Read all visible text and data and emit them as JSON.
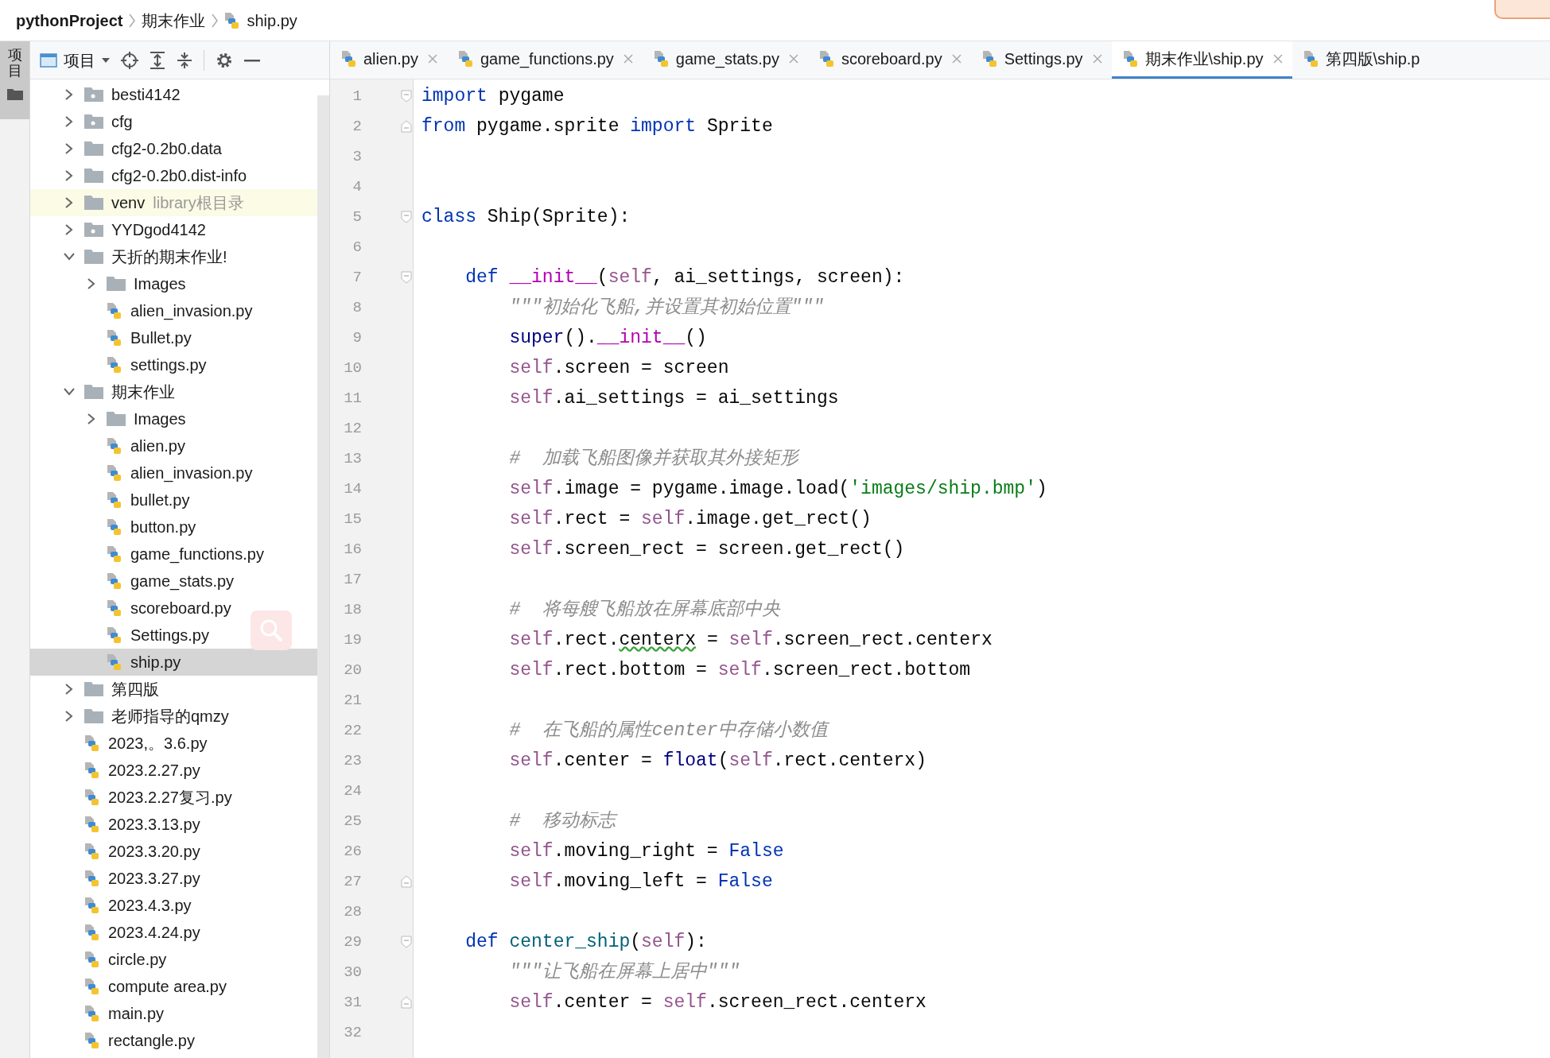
{
  "breadcrumb": [
    {
      "text": "pythonProject",
      "kind": "project"
    },
    {
      "text": "期末作业",
      "kind": "folder"
    },
    {
      "text": "ship.py",
      "kind": "file"
    }
  ],
  "tool_strip": {
    "label": "项目"
  },
  "project_panel": {
    "title": "项目"
  },
  "project_tree": [
    {
      "name": "besti4142",
      "kind": "marked_folder",
      "expanded": false,
      "selected": false,
      "highlighted": false
    },
    {
      "name": "cfg",
      "kind": "marked_folder",
      "expanded": false,
      "selected": false,
      "highlighted": false
    },
    {
      "name": "cfg2-0.2b0.data",
      "kind": "folder",
      "expanded": false,
      "selected": false,
      "highlighted": false
    },
    {
      "name": "cfg2-0.2b0.dist-info",
      "kind": "folder",
      "expanded": false,
      "selected": false,
      "highlighted": false
    },
    {
      "name": "venv",
      "note": "library根目录",
      "kind": "folder",
      "expanded": false,
      "selected": false,
      "highlighted": true
    },
    {
      "name": "YYDgod4142",
      "kind": "marked_folder",
      "expanded": false,
      "selected": false,
      "highlighted": false
    },
    {
      "name": "天折的期末作业!",
      "kind": "folder",
      "expanded": true,
      "selected": false,
      "highlighted": false,
      "children": [
        {
          "name": "Images",
          "kind": "folder",
          "expanded": false,
          "selected": false,
          "highlighted": false
        },
        {
          "name": "alien_invasion.py",
          "kind": "file",
          "selected": false,
          "highlighted": false
        },
        {
          "name": "Bullet.py",
          "kind": "file",
          "selected": false,
          "highlighted": false
        },
        {
          "name": "settings.py",
          "kind": "file",
          "selected": false,
          "highlighted": false
        }
      ]
    },
    {
      "name": "期末作业",
      "kind": "folder",
      "expanded": true,
      "selected": false,
      "highlighted": false,
      "children": [
        {
          "name": "Images",
          "kind": "folder",
          "expanded": false,
          "selected": false,
          "highlighted": false
        },
        {
          "name": "alien.py",
          "kind": "file",
          "selected": false,
          "highlighted": false
        },
        {
          "name": "alien_invasion.py",
          "kind": "file",
          "selected": false,
          "highlighted": false
        },
        {
          "name": "bullet.py",
          "kind": "file",
          "selected": false,
          "highlighted": false
        },
        {
          "name": "button.py",
          "kind": "file",
          "selected": false,
          "highlighted": false
        },
        {
          "name": "game_functions.py",
          "kind": "file",
          "selected": false,
          "highlighted": false
        },
        {
          "name": "game_stats.py",
          "kind": "file",
          "selected": false,
          "highlighted": false
        },
        {
          "name": "scoreboard.py",
          "kind": "file",
          "selected": false,
          "highlighted": false
        },
        {
          "name": "Settings.py",
          "kind": "file",
          "selected": false,
          "highlighted": false
        },
        {
          "name": "ship.py",
          "kind": "file",
          "selected": true,
          "highlighted": false
        }
      ]
    },
    {
      "name": "第四版",
      "kind": "folder",
      "expanded": false,
      "selected": false,
      "highlighted": false
    },
    {
      "name": "老师指导的qmzy",
      "kind": "folder",
      "expanded": false,
      "selected": false,
      "highlighted": false
    },
    {
      "name": "2023,。3.6.py",
      "kind": "file",
      "selected": false,
      "highlighted": false
    },
    {
      "name": "2023.2.27.py",
      "kind": "file",
      "selected": false,
      "highlighted": false
    },
    {
      "name": "2023.2.27复习.py",
      "kind": "file",
      "selected": false,
      "highlighted": false
    },
    {
      "name": "2023.3.13.py",
      "kind": "file",
      "selected": false,
      "highlighted": false
    },
    {
      "name": "2023.3.20.py",
      "kind": "file",
      "selected": false,
      "highlighted": false
    },
    {
      "name": "2023.3.27.py",
      "kind": "file",
      "selected": false,
      "highlighted": false
    },
    {
      "name": "2023.4.3.py",
      "kind": "file",
      "selected": false,
      "highlighted": false
    },
    {
      "name": "2023.4.24.py",
      "kind": "file",
      "selected": false,
      "highlighted": false
    },
    {
      "name": "circle.py",
      "kind": "file",
      "selected": false,
      "highlighted": false
    },
    {
      "name": "compute area.py",
      "kind": "file",
      "selected": false,
      "highlighted": false
    },
    {
      "name": "main.py",
      "kind": "file",
      "selected": false,
      "highlighted": false
    },
    {
      "name": "rectangle.py",
      "kind": "file",
      "selected": false,
      "highlighted": false
    }
  ],
  "tabs": [
    {
      "label": "alien.py",
      "selected": false,
      "closable": true
    },
    {
      "label": "game_functions.py",
      "selected": false,
      "closable": true
    },
    {
      "label": "game_stats.py",
      "selected": false,
      "closable": true
    },
    {
      "label": "scoreboard.py",
      "selected": false,
      "closable": true
    },
    {
      "label": "Settings.py",
      "selected": false,
      "closable": true
    },
    {
      "label": "期末作业\\ship.py",
      "selected": true,
      "closable": true
    },
    {
      "label": "第四版\\ship.p",
      "selected": false,
      "closable": false
    }
  ],
  "editor": {
    "lines": [
      {
        "number": "1",
        "fold_start": true,
        "fold_end": false,
        "code": [
          {
            "kind": "keyword",
            "text": "import"
          },
          {
            "kind": "plain",
            "text": " pygame"
          }
        ]
      },
      {
        "number": "2",
        "fold_start": false,
        "fold_end": true,
        "code": [
          {
            "kind": "keyword",
            "text": "from"
          },
          {
            "kind": "plain",
            "text": " pygame.sprite "
          },
          {
            "kind": "keyword",
            "text": "import"
          },
          {
            "kind": "plain",
            "text": " Sprite"
          }
        ]
      },
      {
        "number": "3",
        "fold_start": false,
        "fold_end": false
      },
      {
        "number": "4",
        "fold_start": false,
        "fold_end": false
      },
      {
        "number": "5",
        "fold_start": true,
        "fold_end": false,
        "code": [
          {
            "kind": "keyword",
            "text": "class"
          },
          {
            "kind": "plain",
            "text": " Ship(Sprite):"
          }
        ]
      },
      {
        "number": "6",
        "fold_start": false,
        "fold_end": false
      },
      {
        "number": "7",
        "fold_start": true,
        "fold_end": false,
        "code": [
          {
            "kind": "keyword",
            "text": "    def "
          },
          {
            "kind": "magic",
            "text": "__init__"
          },
          {
            "kind": "plain",
            "text": "("
          },
          {
            "kind": "self",
            "text": "self"
          },
          {
            "kind": "plain",
            "text": ", ai_settings, screen):"
          }
        ]
      },
      {
        "number": "8",
        "fold_start": false,
        "fold_end": false,
        "code": [
          {
            "kind": "comment",
            "text": "        \"\"\"初始化飞船,并设置其初始位置\"\"\""
          }
        ]
      },
      {
        "number": "9",
        "fold_start": false,
        "fold_end": false,
        "code": [
          {
            "kind": "builtin",
            "text": "        super"
          },
          {
            "kind": "plain",
            "text": "()."
          },
          {
            "kind": "magic",
            "text": "__init__"
          },
          {
            "kind": "plain",
            "text": "()"
          }
        ]
      },
      {
        "number": "10",
        "fold_start": false,
        "fold_end": false,
        "code": [
          {
            "kind": "self",
            "text": "        self"
          },
          {
            "kind": "plain",
            "text": ".screen = screen"
          }
        ]
      },
      {
        "number": "11",
        "fold_start": false,
        "fold_end": false,
        "code": [
          {
            "kind": "self",
            "text": "        self"
          },
          {
            "kind": "plain",
            "text": ".ai_settings = ai_settings"
          }
        ]
      },
      {
        "number": "12",
        "fold_start": false,
        "fold_end": false
      },
      {
        "number": "13",
        "fold_start": false,
        "fold_end": false,
        "code": [
          {
            "kind": "comment",
            "text": "        #  加载飞船图像并获取其外接矩形"
          }
        ]
      },
      {
        "number": "14",
        "fold_start": false,
        "fold_end": false,
        "code": [
          {
            "kind": "self",
            "text": "        self"
          },
          {
            "kind": "plain",
            "text": ".image = pygame.image.load("
          },
          {
            "kind": "string",
            "text": "'images/ship.bmp'"
          },
          {
            "kind": "plain",
            "text": ")"
          }
        ]
      },
      {
        "number": "15",
        "fold_start": false,
        "fold_end": false,
        "code": [
          {
            "kind": "self",
            "text": "        self"
          },
          {
            "kind": "plain",
            "text": ".rect = "
          },
          {
            "kind": "self",
            "text": "self"
          },
          {
            "kind": "plain",
            "text": ".image.get_rect()"
          }
        ]
      },
      {
        "number": "16",
        "fold_start": false,
        "fold_end": false,
        "code": [
          {
            "kind": "self",
            "text": "        self"
          },
          {
            "kind": "plain",
            "text": ".screen_rect = screen.get_rect()"
          }
        ]
      },
      {
        "number": "17",
        "fold_start": false,
        "fold_end": false
      },
      {
        "number": "18",
        "fold_start": false,
        "fold_end": false,
        "code": [
          {
            "kind": "comment",
            "text": "        #  将每艘飞船放在屏幕底部中央"
          }
        ]
      },
      {
        "number": "19",
        "fold_start": false,
        "fold_end": false,
        "code": [
          {
            "kind": "self",
            "text": "        self"
          },
          {
            "kind": "plain",
            "text": ".rect."
          },
          {
            "kind": "typo",
            "text": "centerx"
          },
          {
            "kind": "plain",
            "text": " = "
          },
          {
            "kind": "self",
            "text": "self"
          },
          {
            "kind": "plain",
            "text": ".screen_rect.centerx"
          }
        ]
      },
      {
        "number": "20",
        "fold_start": false,
        "fold_end": false,
        "code": [
          {
            "kind": "self",
            "text": "        self"
          },
          {
            "kind": "plain",
            "text": ".rect.bottom = "
          },
          {
            "kind": "self",
            "text": "self"
          },
          {
            "kind": "plain",
            "text": ".screen_rect.bottom"
          }
        ]
      },
      {
        "number": "21",
        "fold_start": false,
        "fold_end": false
      },
      {
        "number": "22",
        "fold_start": false,
        "fold_end": false,
        "code": [
          {
            "kind": "comment",
            "text": "        #  在飞船的属性center中存储小数值"
          }
        ]
      },
      {
        "number": "23",
        "fold_start": false,
        "fold_end": false,
        "code": [
          {
            "kind": "self",
            "text": "        self"
          },
          {
            "kind": "plain",
            "text": ".center = "
          },
          {
            "kind": "builtin",
            "text": "float"
          },
          {
            "kind": "plain",
            "text": "("
          },
          {
            "kind": "self",
            "text": "self"
          },
          {
            "kind": "plain",
            "text": ".rect.centerx)"
          }
        ]
      },
      {
        "number": "24",
        "fold_start": false,
        "fold_end": false
      },
      {
        "number": "25",
        "fold_start": false,
        "fold_end": false,
        "code": [
          {
            "kind": "comment",
            "text": "        #  移动标志"
          }
        ]
      },
      {
        "number": "26",
        "fold_start": false,
        "fold_end": false,
        "code": [
          {
            "kind": "self",
            "text": "        self"
          },
          {
            "kind": "plain",
            "text": ".moving_right = "
          },
          {
            "kind": "keyword",
            "text": "False"
          }
        ]
      },
      {
        "number": "27",
        "fold_start": false,
        "fold_end": true,
        "code": [
          {
            "kind": "self",
            "text": "        self"
          },
          {
            "kind": "plain",
            "text": ".moving_left = "
          },
          {
            "kind": "keyword",
            "text": "False"
          }
        ]
      },
      {
        "number": "28",
        "fold_start": false,
        "fold_end": false
      },
      {
        "number": "29",
        "fold_start": true,
        "fold_end": false,
        "code": [
          {
            "kind": "keyword",
            "text": "    def "
          },
          {
            "kind": "function",
            "text": "center_ship"
          },
          {
            "kind": "plain",
            "text": "("
          },
          {
            "kind": "self",
            "text": "self"
          },
          {
            "kind": "plain",
            "text": "):"
          }
        ]
      },
      {
        "number": "30",
        "fold_start": false,
        "fold_end": false,
        "code": [
          {
            "kind": "comment",
            "text": "        \"\"\"让飞船在屏幕上居中\"\"\""
          }
        ]
      },
      {
        "number": "31",
        "fold_start": false,
        "fold_end": true,
        "code": [
          {
            "kind": "self",
            "text": "        self"
          },
          {
            "kind": "plain",
            "text": ".center = "
          },
          {
            "kind": "self",
            "text": "self"
          },
          {
            "kind": "plain",
            "text": ".screen_rect.centerx"
          }
        ]
      },
      {
        "number": "32",
        "fold_start": false,
        "fold_end": false
      }
    ]
  }
}
